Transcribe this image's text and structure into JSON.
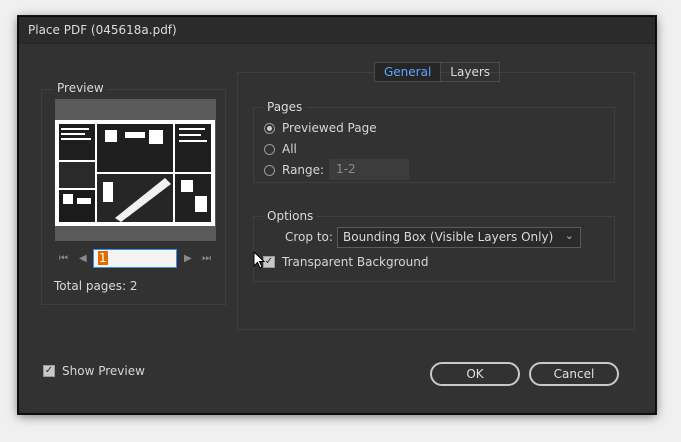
{
  "window": {
    "title": "Place PDF (045618a.pdf)"
  },
  "preview": {
    "legend": "Preview",
    "page_value": "1",
    "total_pages_label": "Total pages: 2",
    "nav": {
      "first": "⏮",
      "prev": "◀",
      "next": "▶",
      "last": "⏭"
    }
  },
  "tabs": [
    {
      "label": "General",
      "active": true
    },
    {
      "label": "Layers",
      "active": false
    }
  ],
  "pages": {
    "legend": "Pages",
    "options": [
      {
        "label": "Previewed Page",
        "selected": true
      },
      {
        "label": "All",
        "selected": false
      },
      {
        "label": "Range:",
        "selected": false
      }
    ],
    "range_value": "1-2"
  },
  "options": {
    "legend": "Options",
    "crop_label": "Crop to:",
    "crop_value": "Bounding Box (Visible Layers Only)",
    "transparent_bg_label": "Transparent Background",
    "transparent_bg_checked": true
  },
  "footer": {
    "show_preview_label": "Show Preview",
    "show_preview_checked": true,
    "ok_label": "OK",
    "cancel_label": "Cancel"
  },
  "colors": {
    "dialog_bg": "#323232",
    "active_tab": "#5ea4ff",
    "selection": "#e06c00"
  }
}
